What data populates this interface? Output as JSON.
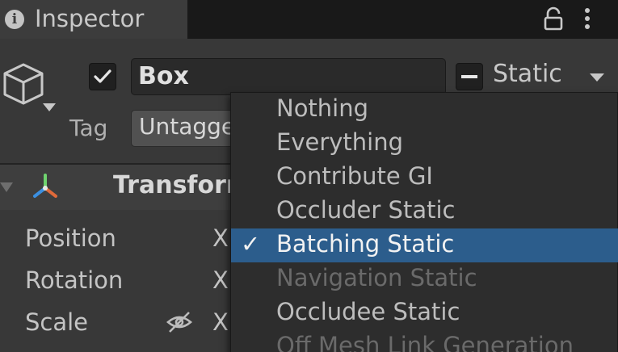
{
  "tab": {
    "label": "Inspector",
    "info_icon": "i"
  },
  "object": {
    "name": "Box",
    "active": true,
    "static_label": "Static",
    "tag_label": "Tag",
    "tag_value": "Untagged"
  },
  "transform": {
    "title": "Transform",
    "rows": [
      {
        "label": "Position",
        "axis": "X"
      },
      {
        "label": "Rotation",
        "axis": "X"
      },
      {
        "label": "Scale",
        "axis": "X"
      }
    ]
  },
  "static_menu": {
    "items": [
      {
        "label": "Nothing",
        "checked": false,
        "disabled": false
      },
      {
        "label": "Everything",
        "checked": false,
        "disabled": false
      },
      {
        "label": "Contribute GI",
        "checked": false,
        "disabled": false
      },
      {
        "label": "Occluder Static",
        "checked": false,
        "disabled": false
      },
      {
        "label": "Batching Static",
        "checked": true,
        "disabled": false
      },
      {
        "label": "Navigation Static",
        "checked": false,
        "disabled": true
      },
      {
        "label": "Occludee Static",
        "checked": false,
        "disabled": false
      },
      {
        "label": "Off Mesh Link Generation",
        "checked": false,
        "disabled": true
      }
    ],
    "check_glyph": "✓",
    "selected_color": "#2c5d8c"
  },
  "icons": {
    "tab": "info-icon",
    "lock": "lock-icon",
    "menu": "kebab-menu-icon",
    "object": "cube-icon",
    "transform": "transform-axes-icon",
    "scale_link": "link-broken-icon"
  }
}
